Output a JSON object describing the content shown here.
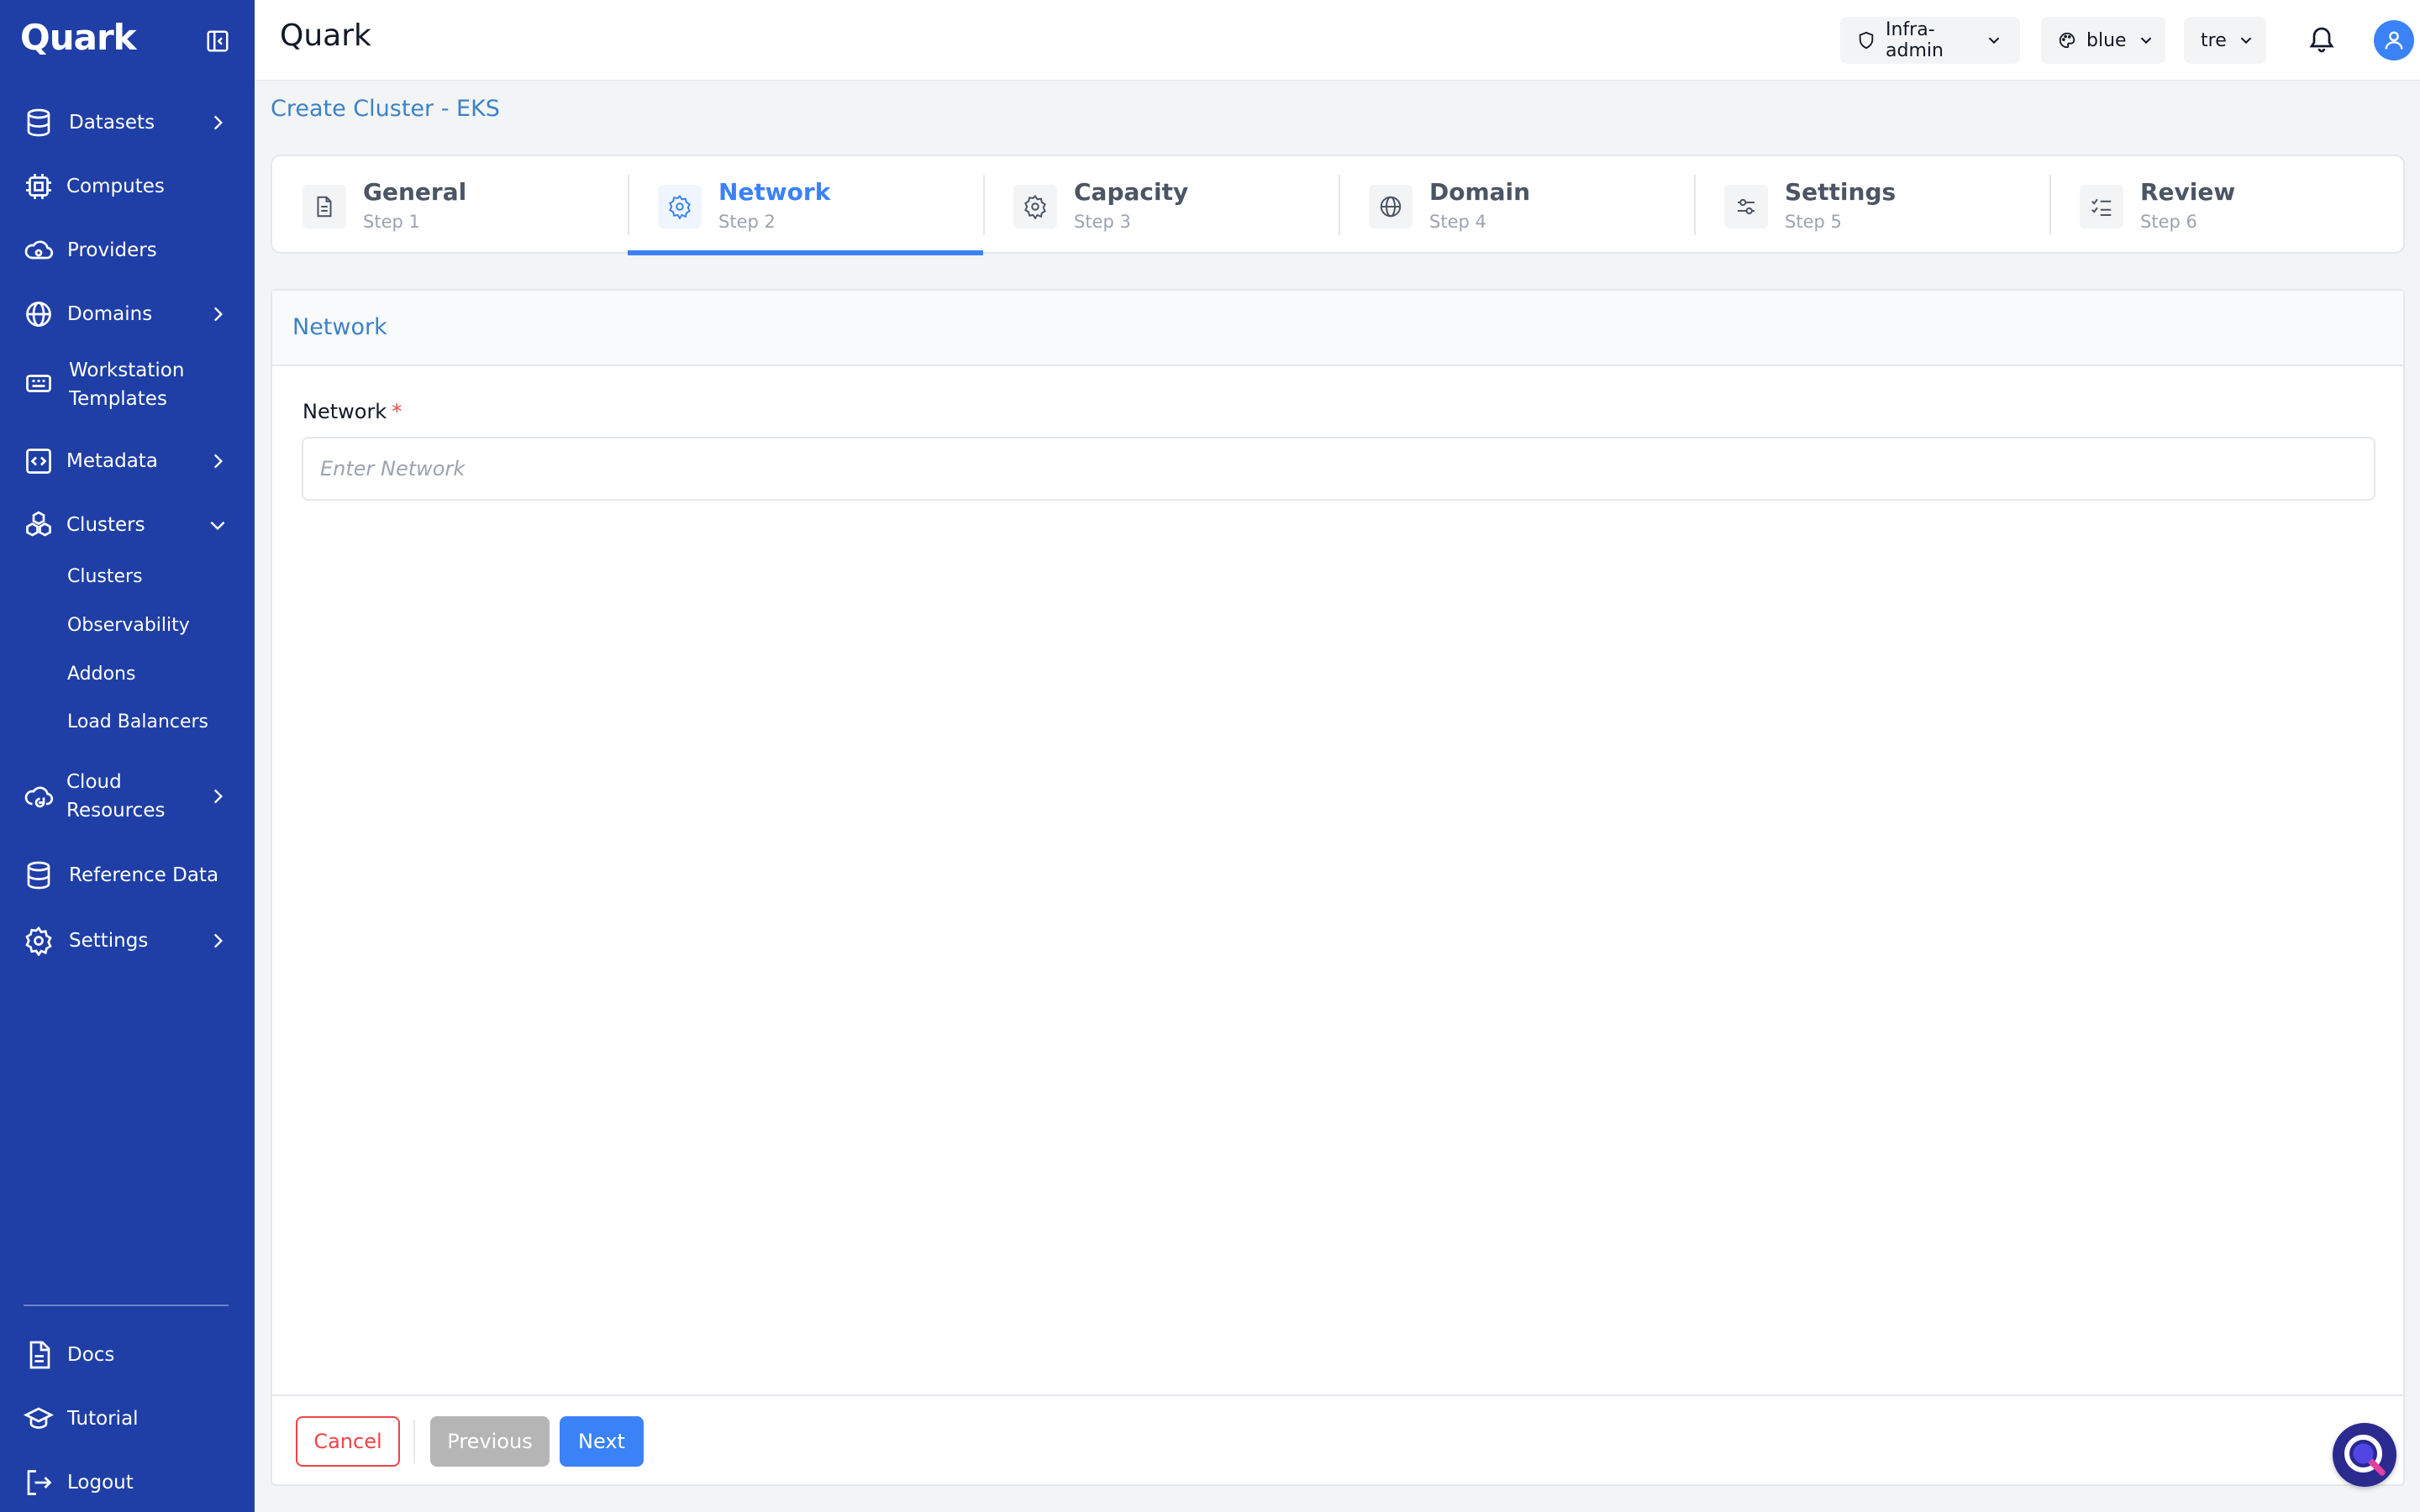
{
  "app": {
    "brand": "Quark",
    "title": "Quark"
  },
  "sidebar": {
    "items": [
      {
        "label": "Datasets",
        "icon": "database-icon",
        "has_chevron": true
      },
      {
        "label": "Computes",
        "icon": "cpu-icon",
        "has_chevron": false
      },
      {
        "label": "Providers",
        "icon": "cloud-provider-icon",
        "has_chevron": false
      },
      {
        "label": "Domains",
        "icon": "globe-icon",
        "has_chevron": true
      },
      {
        "label": "Workstation",
        "label2": "Templates",
        "icon": "workstation-icon",
        "has_chevron": false
      },
      {
        "label": "Metadata",
        "icon": "code-icon",
        "has_chevron": true
      },
      {
        "label": "Clusters",
        "icon": "cluster-icon",
        "has_chevron": true,
        "expanded": true
      },
      {
        "label": "Cloud",
        "label2": "Resources",
        "icon": "cloud-refresh-icon",
        "has_chevron": true
      },
      {
        "label": "Reference Data",
        "icon": "database-icon",
        "has_chevron": false
      },
      {
        "label": "Settings",
        "icon": "gear-icon",
        "has_chevron": true
      }
    ],
    "cluster_subitems": [
      "Clusters",
      "Observability",
      "Addons",
      "Load Balancers"
    ],
    "bottom_items": [
      {
        "label": "Docs",
        "icon": "document-icon"
      },
      {
        "label": "Tutorial",
        "icon": "graduation-cap-icon"
      },
      {
        "label": "Logout",
        "icon": "logout-icon"
      }
    ]
  },
  "header": {
    "role_select": "Infra-admin",
    "theme_select": "blue",
    "tenant_select": "tre"
  },
  "page": {
    "title": "Create Cluster - EKS"
  },
  "stepper": {
    "steps": [
      {
        "title": "General",
        "sub": "Step 1",
        "icon": "file-icon"
      },
      {
        "title": "Network",
        "sub": "Step 2",
        "icon": "gear-icon",
        "active": true
      },
      {
        "title": "Capacity",
        "sub": "Step 3",
        "icon": "gear-icon"
      },
      {
        "title": "Domain",
        "sub": "Step 4",
        "icon": "globe-icon"
      },
      {
        "title": "Settings",
        "sub": "Step 5",
        "icon": "sliders-icon"
      },
      {
        "title": "Review",
        "sub": "Step 6",
        "icon": "checklist-icon"
      }
    ]
  },
  "form": {
    "section_title": "Network",
    "network_label": "Network",
    "required_marker": "*",
    "network_value": "",
    "network_placeholder": "Enter Network"
  },
  "actions": {
    "cancel": "Cancel",
    "previous": "Previous",
    "next": "Next"
  },
  "colors": {
    "sidebar": "#1f3fa6",
    "accent": "#3b82f6",
    "danger": "#ef4444",
    "disabled": "#b5b5b5"
  }
}
